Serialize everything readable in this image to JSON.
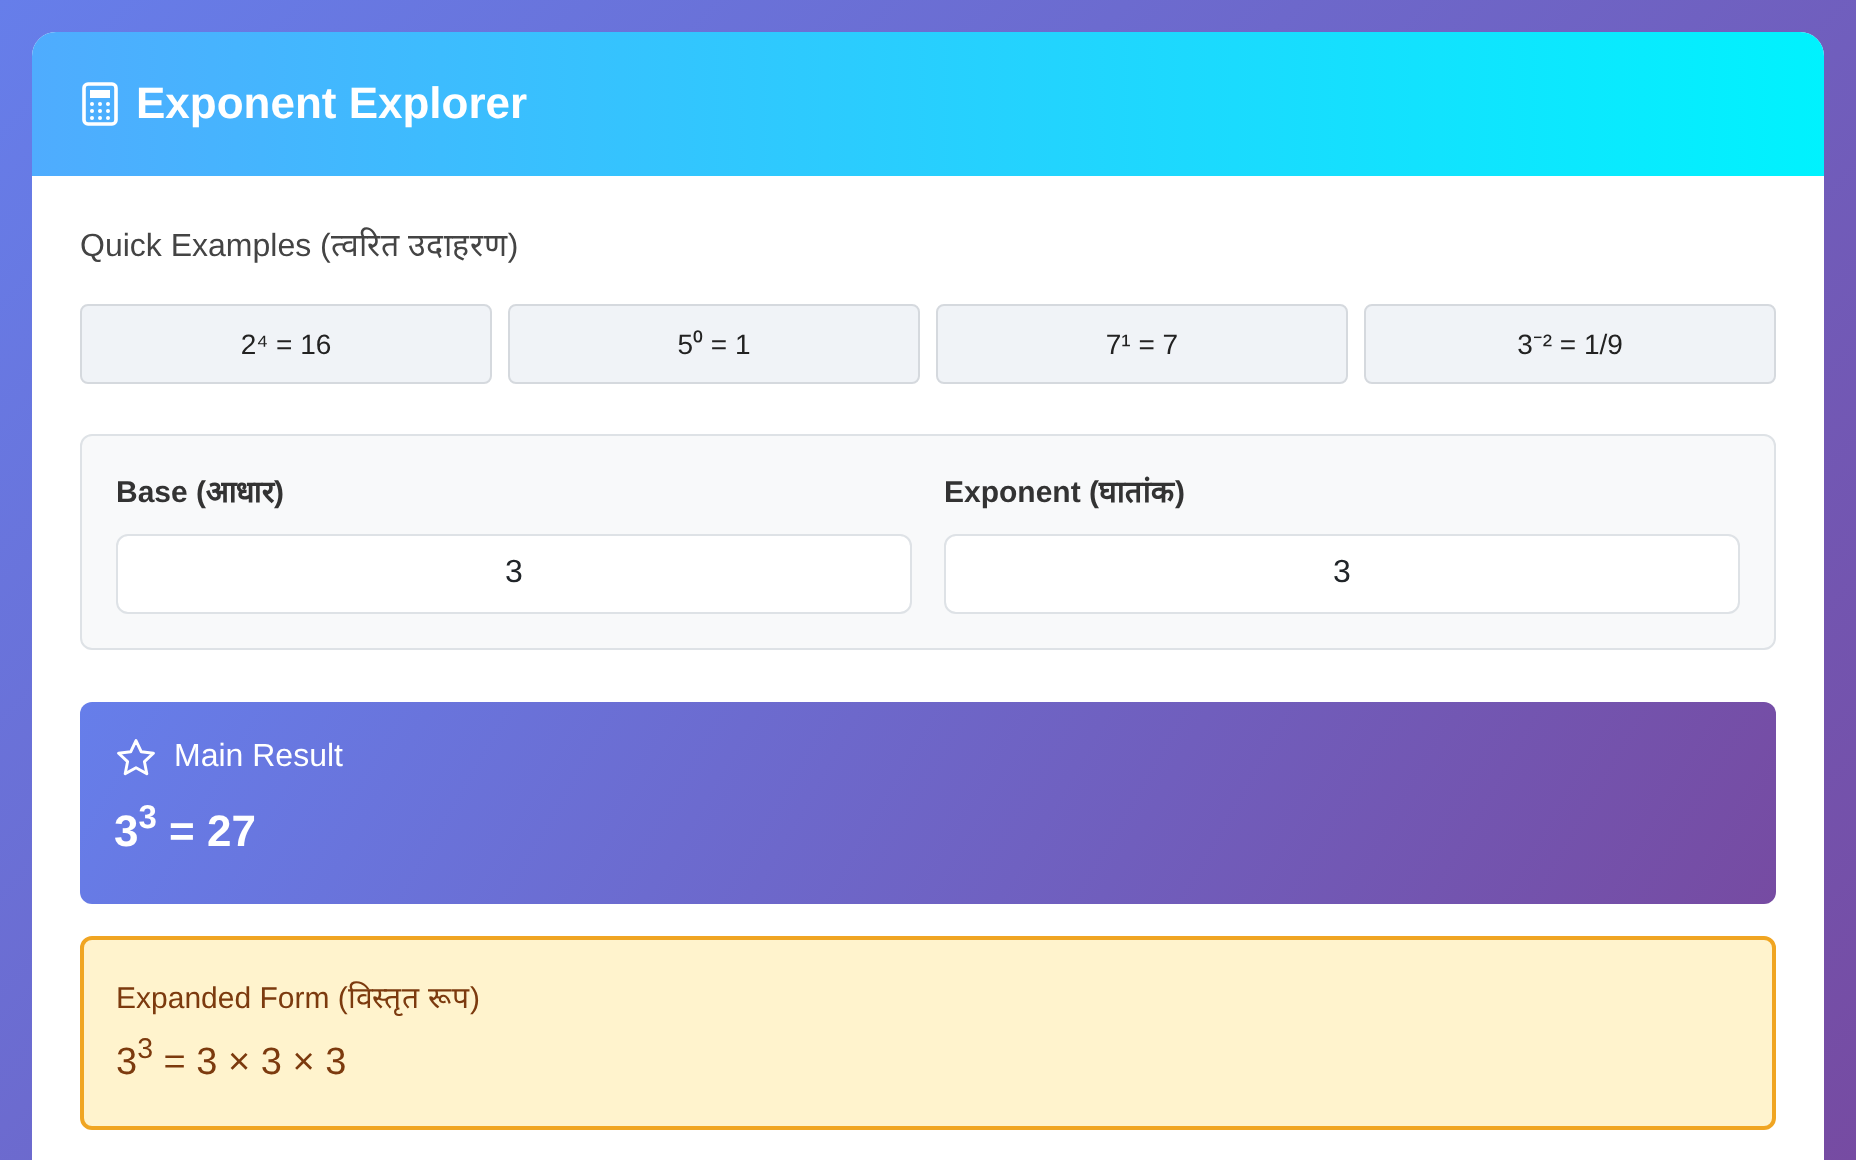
{
  "header": {
    "title": "Exponent Explorer"
  },
  "quick_examples": {
    "label": "Quick Examples (त्वरित उदाहरण)",
    "buttons": [
      "2⁴ = 16",
      "5⁰ = 1",
      "7¹ = 7",
      "3⁻² = 1/9"
    ]
  },
  "inputs": [
    {
      "label": "Base (आधार)",
      "value": "3"
    },
    {
      "label": "Exponent (घातांक)",
      "value": "3"
    }
  ],
  "main_result": {
    "label": "Main Result",
    "value": "3$^{3}$ = 27"
  },
  "expanded_form": {
    "label": "Expanded Form (विस्तृत रूप)",
    "value": "3$^{3}$ = 3 × 3 × 3"
  }
}
